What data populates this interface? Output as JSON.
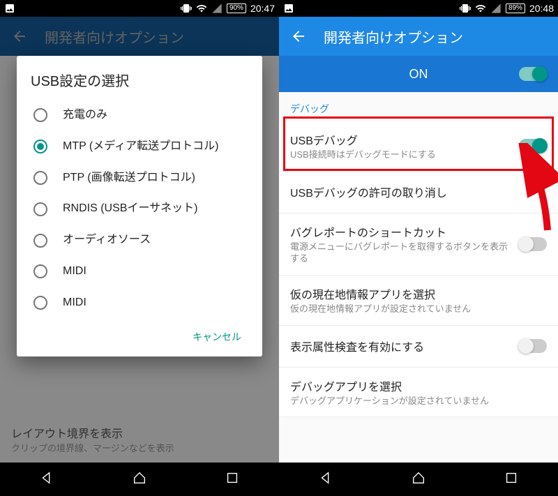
{
  "left": {
    "status": {
      "battery": "90%",
      "time": "20:47"
    },
    "appbar_title": "開発者向けオプション",
    "dialog": {
      "title": "USB設定の選択",
      "options": [
        {
          "label": "充電のみ",
          "selected": false
        },
        {
          "label": "MTP (メディア転送プロトコル)",
          "selected": true
        },
        {
          "label": "PTP (画像転送プロトコル)",
          "selected": false
        },
        {
          "label": "RNDIS (USBイーサネット)",
          "selected": false
        },
        {
          "label": "オーディオソース",
          "selected": false
        },
        {
          "label": "MIDI",
          "selected": false
        },
        {
          "label": "MIDI",
          "selected": false
        }
      ],
      "cancel": "キャンセル"
    },
    "bg_item": {
      "title": "レイアウト境界を表示",
      "sub": "クリップの境界線、マージンなどを表示"
    }
  },
  "right": {
    "status": {
      "battery": "89%",
      "time": "20:48"
    },
    "appbar_title": "開発者向けオプション",
    "master_label": "ON",
    "section": "デバッグ",
    "items": [
      {
        "title": "USBデバッグ",
        "sub": "USB接続時はデバッグモードにする",
        "toggle": "on"
      },
      {
        "title": "USBデバッグの許可の取り消し",
        "sub": "",
        "toggle": "none"
      },
      {
        "title": "バグレポートのショートカット",
        "sub": "電源メニューにバグレポートを取得するボタンを表示する",
        "toggle": "off"
      },
      {
        "title": "仮の現在地情報アプリを選択",
        "sub": "仮の現在地情報アプリが設定されていません",
        "toggle": "none"
      },
      {
        "title": "表示属性検査を有効にする",
        "sub": "",
        "toggle": "off"
      },
      {
        "title": "デバッグアプリを選択",
        "sub": "デバッグアプリケーションが設定されていません",
        "toggle": "none"
      }
    ]
  }
}
